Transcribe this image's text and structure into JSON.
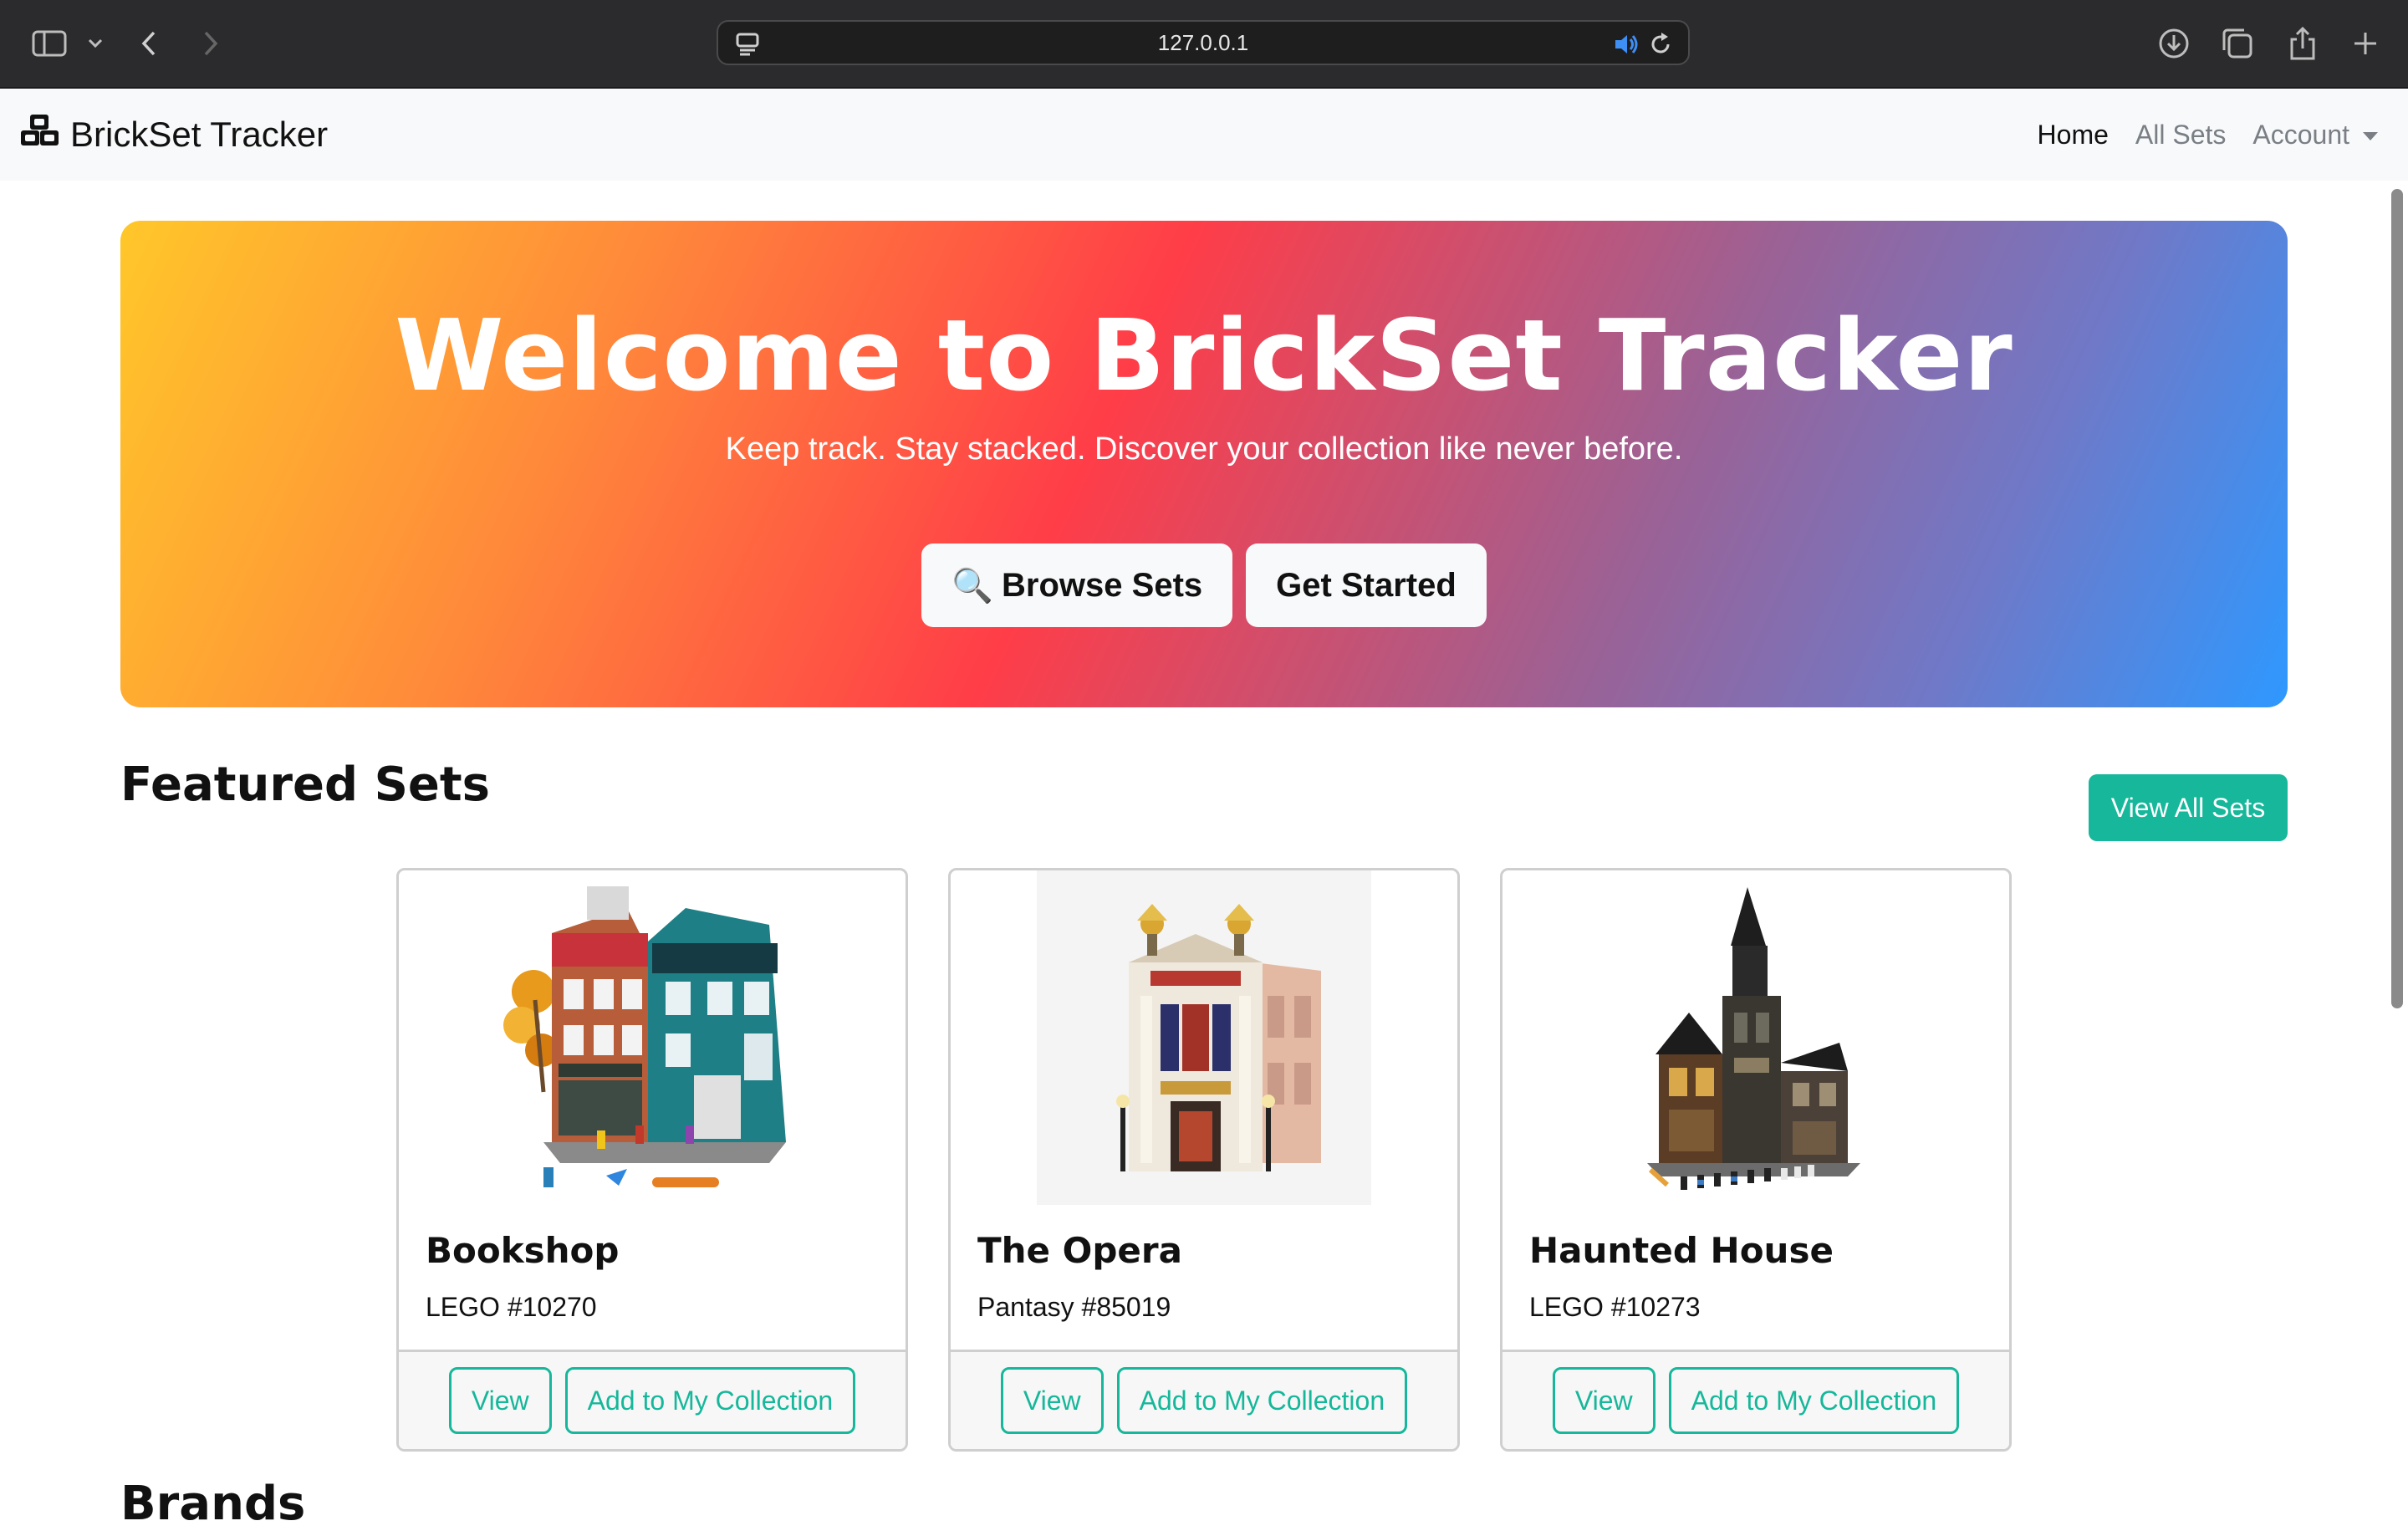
{
  "browser": {
    "url": "127.0.0.1"
  },
  "navbar": {
    "brand": "BrickSet Tracker",
    "links": [
      {
        "label": "Home"
      },
      {
        "label": "All Sets"
      },
      {
        "label": "Account"
      }
    ]
  },
  "hero": {
    "title": "Welcome to BrickSet Tracker",
    "subtitle": "Keep track. Stay stacked. Discover your collection like never before.",
    "browse_label": "Browse Sets",
    "browse_icon": "🔍",
    "start_label": "Get Started",
    "gradient_colors": [
      "#ffc72a",
      "#ff3d48",
      "#2e98ff"
    ]
  },
  "featured": {
    "heading": "Featured Sets",
    "view_all_label": "View All Sets",
    "accent": "#16b79a",
    "cards": [
      {
        "title": "Bookshop",
        "sub": "LEGO #10270",
        "view_label": "View",
        "add_label": "Add to My Collection"
      },
      {
        "title": "The Opera",
        "sub": "Pantasy #85019",
        "view_label": "View",
        "add_label": "Add to My Collection"
      },
      {
        "title": "Haunted House",
        "sub": "LEGO #10273",
        "view_label": "View",
        "add_label": "Add to My Collection"
      }
    ]
  },
  "brands": {
    "heading": "Brands"
  }
}
